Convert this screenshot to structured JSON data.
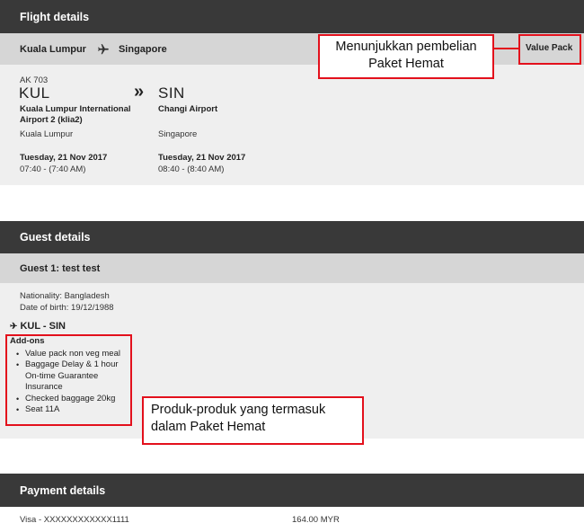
{
  "flight": {
    "header": "Flight details",
    "route_from": "Kuala Lumpur",
    "route_to": "Singapore",
    "value_pack_label": "Value Pack",
    "flight_number": "AK 703",
    "origin": {
      "code": "KUL",
      "airport": "Kuala Lumpur International Airport 2 (klia2)",
      "city": "Kuala Lumpur",
      "date": "Tuesday, 21 Nov 2017",
      "time": "07:40 - (7:40 AM)"
    },
    "arrow": "»",
    "destination": {
      "code": "SIN",
      "airport": "Changi Airport",
      "city": "Singapore",
      "date": "Tuesday, 21 Nov 2017",
      "time": "08:40 - (8:40 AM)"
    }
  },
  "annotations": {
    "value_pack_note": "Menunjukkan pembelian Paket Hemat",
    "products_note": "Produk-produk yang termasuk dalam Paket Hemat"
  },
  "guest": {
    "header": "Guest details",
    "guest_title": "Guest 1: test test",
    "nationality": "Nationality: Bangladesh",
    "dob": "Date of birth: 19/12/1988",
    "route": "KUL - SIN",
    "addons_title": "Add-ons",
    "addons": [
      "Value pack non veg meal",
      "Baggage Delay & 1 hour On-time Guarantee Insurance",
      "Checked baggage 20kg",
      "Seat 11A"
    ]
  },
  "payment": {
    "header": "Payment details",
    "method": "Visa - XXXXXXXXXXXX1111",
    "amount": "164.00 MYR"
  },
  "colors": {
    "header_bg": "#393939",
    "subheader_bg": "#d6d6d6",
    "panel_bg": "#efefef",
    "highlight": "#e3101c"
  }
}
